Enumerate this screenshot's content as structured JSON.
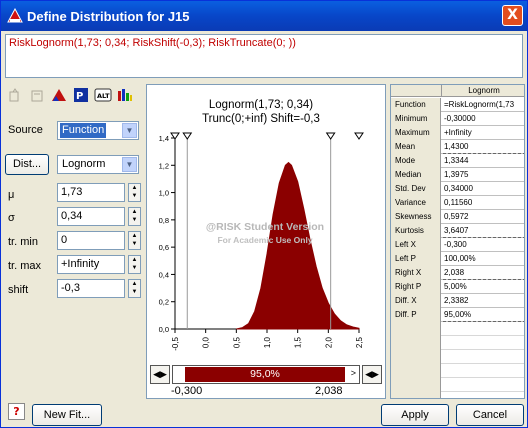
{
  "window": {
    "title": "Define Distribution for J15",
    "close_glyph": "X"
  },
  "formula": "RiskLognorm(1,73; 0,34;  RiskShift(-0,3); RiskTruncate(0; ))",
  "toolbar": {
    "buttons": [
      "copy-icon",
      "paste-icon",
      "triangle-icon",
      "dist-fit-icon",
      "alt-param-icon",
      "bar-chart-icon"
    ],
    "alt_label": "ALT"
  },
  "left": {
    "source_label": "Source",
    "source_value": "Function",
    "dist_button": "Dist...",
    "dist_value": "Lognorm",
    "params": [
      {
        "label": "μ",
        "value": "1,73"
      },
      {
        "label": "σ",
        "value": "0,34"
      },
      {
        "label": "tr. min",
        "value": "0"
      },
      {
        "label": "tr. max",
        "value": "+Infinity"
      },
      {
        "label": "shift",
        "value": "-0,3"
      }
    ]
  },
  "chart": {
    "title_line1": "Lognorm(1,73; 0,34)",
    "title_line2": "Trunc(0;+inf) Shift=-0,3",
    "watermark1": "@RISK Student Version",
    "watermark2": "For Academic Use Only",
    "fill_color": "#8b0000",
    "slider": {
      "left_value": "-0,300",
      "right_value": "2,038",
      "percent_label": "95,0%",
      "arrow": ">"
    }
  },
  "chart_data": {
    "type": "area",
    "title": "Lognorm(1,73; 0,34)",
    "subtitle": "Trunc(0;+inf) Shift=-0,3",
    "xlabel": "",
    "ylabel": "",
    "xlim": [
      -0.5,
      2.5
    ],
    "ylim": [
      0,
      1.4
    ],
    "x_ticks": [
      "-0,5",
      "0,0",
      "0,5",
      "1,0",
      "1,5",
      "2,0",
      "2,5"
    ],
    "y_ticks": [
      "0,0",
      "0,2",
      "0,4",
      "0,6",
      "0,8",
      "1,0",
      "1,2",
      "1,4"
    ],
    "x": [
      0.5,
      0.6,
      0.7,
      0.8,
      0.9,
      1.0,
      1.1,
      1.2,
      1.3,
      1.35,
      1.4,
      1.5,
      1.6,
      1.7,
      1.8,
      1.9,
      2.0,
      2.1,
      2.2,
      2.3,
      2.4,
      2.5
    ],
    "y": [
      0.0,
      0.01,
      0.04,
      0.13,
      0.3,
      0.55,
      0.84,
      1.07,
      1.2,
      1.22,
      1.2,
      1.08,
      0.88,
      0.66,
      0.46,
      0.3,
      0.19,
      0.11,
      0.06,
      0.03,
      0.015,
      0.005
    ],
    "markers": [
      -0.3,
      2.038
    ],
    "grid": false
  },
  "stats": {
    "header": "Lognorm",
    "rows": [
      {
        "label": "Function",
        "value": "=RiskLognorm(1,73"
      },
      {
        "label": "Minimum",
        "value": "-0,30000"
      },
      {
        "label": "Maximum",
        "value": "+Infinity"
      },
      {
        "label": "Mean",
        "value": "1,4300"
      },
      {
        "label": "Mode",
        "value": "1,3344"
      },
      {
        "label": "Median",
        "value": "1,3975"
      },
      {
        "label": "Std. Dev",
        "value": "0,34000"
      },
      {
        "label": "Variance",
        "value": "0,11560"
      },
      {
        "label": "Skewness",
        "value": "0,5972"
      },
      {
        "label": "Kurtosis",
        "value": "3,6407"
      },
      {
        "label": "Left X",
        "value": "-0,300"
      },
      {
        "label": "Left P",
        "value": "100,00%"
      },
      {
        "label": "Right X",
        "value": "2,038"
      },
      {
        "label": "Right P",
        "value": "5,00%"
      },
      {
        "label": "Diff. X",
        "value": "2,3382"
      },
      {
        "label": "Diff. P",
        "value": "95,00%"
      }
    ]
  },
  "buttons": {
    "help": "?",
    "new_fit": "New Fit...",
    "apply": "Apply",
    "cancel": "Cancel"
  }
}
